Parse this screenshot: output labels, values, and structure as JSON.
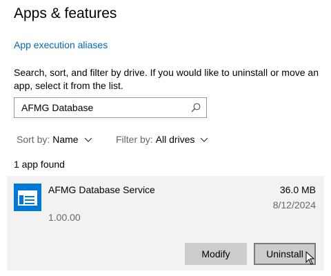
{
  "page": {
    "title": "Apps & features",
    "aliases_link": "App execution aliases",
    "description": "Search, sort, and filter by drive. If you would like to uninstall or move an app, select it from the list."
  },
  "search": {
    "value": "AFMG Database",
    "icon": "search-icon"
  },
  "sort": {
    "label": "Sort by:",
    "value": "Name"
  },
  "filter": {
    "label": "Filter by:",
    "value": "All drives"
  },
  "results": {
    "count_text": "1 app found"
  },
  "app": {
    "name": "AFMG Database Service",
    "size": "36.0 MB",
    "date": "8/12/2024",
    "version": "1.00.00",
    "modify_label": "Modify",
    "uninstall_label": "Uninstall"
  },
  "colors": {
    "accent": "#0067b8",
    "icon_bg": "#0078d7",
    "card_bg": "#f2f2f2",
    "button_bg": "#cccccc"
  }
}
